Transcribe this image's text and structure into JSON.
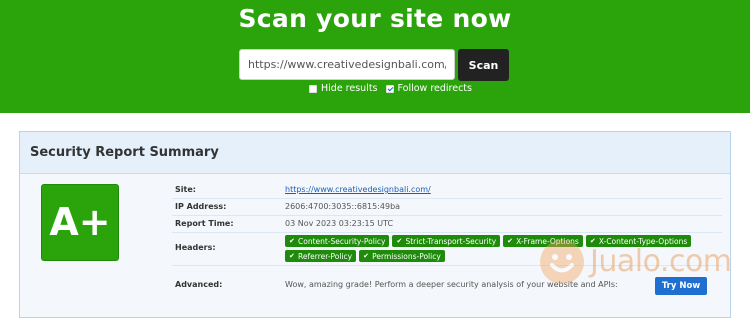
{
  "hero": {
    "title": "Scan your site now",
    "url_value": "https://www.creativedesignbali.com/",
    "scan_label": "Scan",
    "options": [
      {
        "label": "Hide results",
        "checked": false
      },
      {
        "label": "Follow redirects",
        "checked": true
      }
    ],
    "bg_color": "#2ba40c"
  },
  "report": {
    "title": "Security Report Summary",
    "grade": "A+",
    "rows": {
      "site": {
        "label": "Site:",
        "value": "https://www.creativedesignbali.com/"
      },
      "ip": {
        "label": "IP Address:",
        "value": "2606:4700:3035::6815:49ba"
      },
      "time": {
        "label": "Report Time:",
        "value": "03 Nov 2023 03:23:15 UTC"
      },
      "headers": {
        "label": "Headers:",
        "items": [
          "Content-Security-Policy",
          "Strict-Transport-Security",
          "X-Frame-Options",
          "X-Content-Type-Options",
          "Referrer-Policy",
          "Permissions-Policy"
        ]
      },
      "advanced": {
        "label": "Advanced:",
        "value": "Wow, amazing grade! Perform a deeper security analysis of your website and APIs:",
        "button": "Try Now"
      }
    }
  },
  "watermark": {
    "text": "Jualo.com"
  }
}
